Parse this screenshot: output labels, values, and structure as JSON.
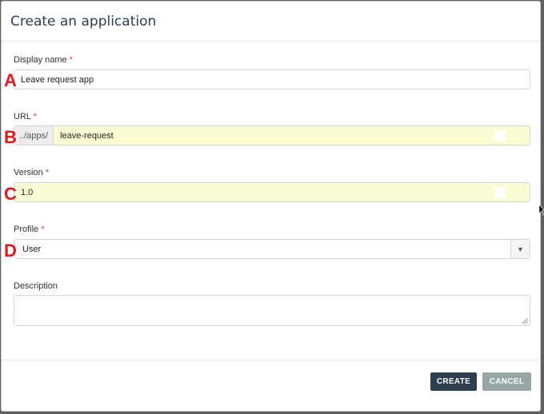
{
  "dialog": {
    "title": "Create an application",
    "required_marker": "*"
  },
  "fields": {
    "display_name": {
      "label": "Display name",
      "value": "Leave request app",
      "marker": "A"
    },
    "url": {
      "label": "URL",
      "prefix": "../apps/",
      "value": "leave-request",
      "marker": "B"
    },
    "version": {
      "label": "Version",
      "value": "1.0",
      "marker": "C"
    },
    "profile": {
      "label": "Profile",
      "value": "User",
      "marker": "D"
    },
    "description": {
      "label": "Description",
      "value": ""
    }
  },
  "buttons": {
    "create": "CREATE",
    "cancel": "CANCEL"
  },
  "colors": {
    "primary": "#2c3e50",
    "secondary": "#97a6a6",
    "autofill": "#fafcd4",
    "marker": "#e8141b"
  },
  "icons": {
    "dropdown": "chevron-down-icon"
  }
}
